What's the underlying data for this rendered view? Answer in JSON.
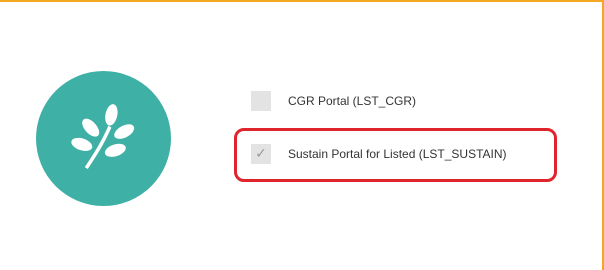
{
  "logo": {
    "icon": "leaf-sprig-icon",
    "color": "#3fb0a5"
  },
  "options": [
    {
      "label": "CGR Portal (LST_CGR)",
      "checked": false,
      "check_glyph": ""
    },
    {
      "label": "Sustain Portal for Listed (LST_SUSTAIN)",
      "checked": true,
      "check_glyph": "✓"
    }
  ],
  "colors": {
    "frame": "#f5a623",
    "highlight": "#e0242b",
    "checkbox": "#e3e3e3"
  }
}
